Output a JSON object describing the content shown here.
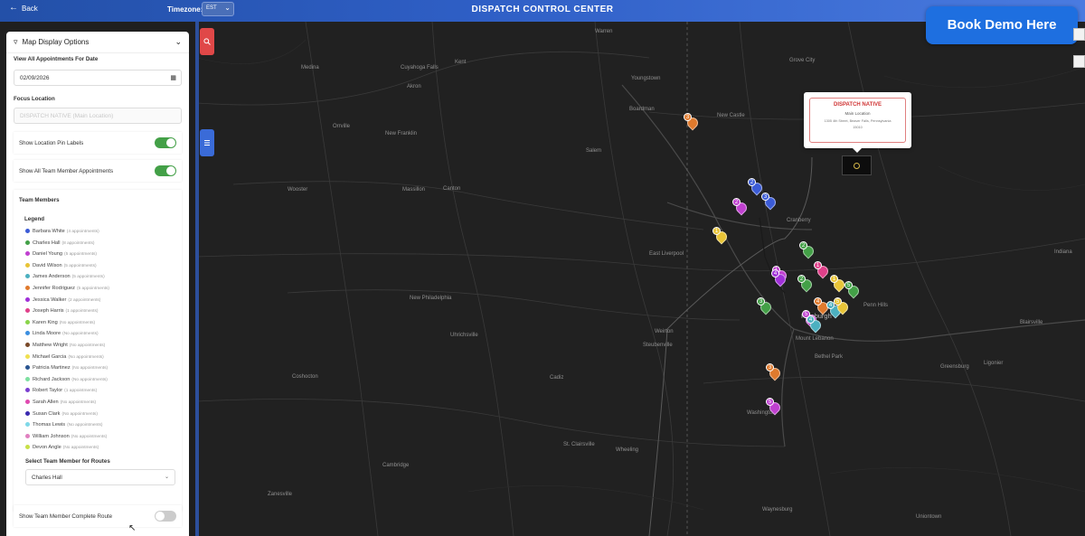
{
  "topbar": {
    "back_label": "Back",
    "timezone_label": "Timezone:",
    "timezone_value": "EST",
    "title": "DISPATCH CONTROL CENTER"
  },
  "demo_button": "Book Demo Here",
  "sidebar": {
    "header": "Map Display Options",
    "date_label": "View All Appointments For Date",
    "date_value": "02/09/2026",
    "focus_label": "Focus Location",
    "focus_value": "DISPATCH NATIVE (Main Location)",
    "show_pin_labels": "Show Location Pin Labels",
    "show_all_appointments": "Show All Team Member Appointments",
    "team_members_title": "Team Members",
    "legend_title": "Legend",
    "legend": [
      {
        "name": "Barbara White",
        "count": "(4 appointments)",
        "color": "#3b5bd6"
      },
      {
        "name": "Charles Hall",
        "count": "(8 appointments)",
        "color": "#43a047"
      },
      {
        "name": "Daniel Young",
        "count": "(5 appointments)",
        "color": "#c040d0"
      },
      {
        "name": "David Wilson",
        "count": "(5 appointments)",
        "color": "#e8c437"
      },
      {
        "name": "James Anderson",
        "count": "(5 appointments)",
        "color": "#4cb0c0"
      },
      {
        "name": "Jennifer Rodriguez",
        "count": "(5 appointments)",
        "color": "#e07a2d"
      },
      {
        "name": "Jessica Walker",
        "count": "(2 appointments)",
        "color": "#a030d8"
      },
      {
        "name": "Joseph Harris",
        "count": "(1 appointments)",
        "color": "#e0408a"
      },
      {
        "name": "Karen King",
        "count": "(No appointments)",
        "color": "#8ad44a"
      },
      {
        "name": "Linda Moore",
        "count": "(No appointments)",
        "color": "#3c8fe0"
      },
      {
        "name": "Matthew Wright",
        "count": "(No appointments)",
        "color": "#7a4a2a"
      },
      {
        "name": "Michael Garcia",
        "count": "(No appointments)",
        "color": "#f0e050"
      },
      {
        "name": "Patricia Martinez",
        "count": "(No appointments)",
        "color": "#2a5590"
      },
      {
        "name": "Richard Jackson",
        "count": "(No appointments)",
        "color": "#7de0a0"
      },
      {
        "name": "Robert Taylor",
        "count": "(1 appointments)",
        "color": "#7a3fd0"
      },
      {
        "name": "Sarah Allen",
        "count": "(No appointments)",
        "color": "#e04ab0"
      },
      {
        "name": "Susan Clark",
        "count": "(No appointments)",
        "color": "#3a2ab0"
      },
      {
        "name": "Thomas Lewis",
        "count": "(No appointments)",
        "color": "#7fd8e8"
      },
      {
        "name": "William Johnson",
        "count": "(No appointments)",
        "color": "#e080c0"
      },
      {
        "name": "Devon Angle",
        "count": "(No appointments)",
        "color": "#c8e048"
      }
    ],
    "routes_label": "Select Team Member for Routes",
    "routes_value": "Charles Hall",
    "complete_route": "Show Team Member Complete Route"
  },
  "popup": {
    "title": "DISPATCH NATIVE",
    "subtitle": "Main Location",
    "address": "1305 4th Street, Beaver Falls, Pennsylvania",
    "zip": "15010"
  },
  "cities": [
    {
      "name": "Warren",
      "big": false
    },
    {
      "name": "Medina",
      "big": false
    },
    {
      "name": "Cuyahoga Falls",
      "big": false
    },
    {
      "name": "Kent",
      "big": false
    },
    {
      "name": "Akron",
      "big": false
    },
    {
      "name": "Youngstown",
      "big": false
    },
    {
      "name": "Grove City",
      "big": false
    },
    {
      "name": "Boardman",
      "big": false
    },
    {
      "name": "New Castle",
      "big": false
    },
    {
      "name": "Orrville",
      "big": false
    },
    {
      "name": "New Franklin",
      "big": false
    },
    {
      "name": "Salem",
      "big": false
    },
    {
      "name": "Wooster",
      "big": false
    },
    {
      "name": "Massillon",
      "big": false
    },
    {
      "name": "Canton",
      "big": false
    },
    {
      "name": "Cranberry",
      "big": false
    },
    {
      "name": "Indiana",
      "big": false
    },
    {
      "name": "East Liverpool",
      "big": false
    },
    {
      "name": "New Philadelphia",
      "big": false
    },
    {
      "name": "Pittsburgh",
      "big": true
    },
    {
      "name": "Penn Hills",
      "big": false
    },
    {
      "name": "Weirton",
      "big": false
    },
    {
      "name": "Steubenville",
      "big": false
    },
    {
      "name": "Mount Lebanon",
      "big": false
    },
    {
      "name": "Blairsville",
      "big": false
    },
    {
      "name": "Uhrichsville",
      "big": false
    },
    {
      "name": "Bethel Park",
      "big": false
    },
    {
      "name": "Greensburg",
      "big": false
    },
    {
      "name": "Coshocton",
      "big": false
    },
    {
      "name": "Cadiz",
      "big": false
    },
    {
      "name": "Ligonier",
      "big": false
    },
    {
      "name": "Washington",
      "big": false
    },
    {
      "name": "St. Clairsville",
      "big": false
    },
    {
      "name": "Wheeling",
      "big": false
    },
    {
      "name": "Cambridge",
      "big": false
    },
    {
      "name": "Zanesville",
      "big": false
    },
    {
      "name": "Uniontown",
      "big": false
    },
    {
      "name": "Waynesburg",
      "big": false
    }
  ],
  "pins": [
    {
      "n": "3",
      "color": "#e07a2d"
    },
    {
      "n": "2",
      "color": "#3b5bd6"
    },
    {
      "n": "3",
      "color": "#3b5bd6"
    },
    {
      "n": "2",
      "color": "#c040d0"
    },
    {
      "n": "1",
      "color": "#e8c437"
    },
    {
      "n": "2",
      "color": "#43a047"
    },
    {
      "n": "1",
      "color": "#c040d0"
    },
    {
      "n": "4",
      "color": "#a030d8"
    },
    {
      "n": "1",
      "color": "#e0408a"
    },
    {
      "n": "2",
      "color": "#43a047"
    },
    {
      "n": "1",
      "color": "#e8c437"
    },
    {
      "n": "5",
      "color": "#43a047"
    },
    {
      "n": "3",
      "color": "#43a047"
    },
    {
      "n": "4",
      "color": "#e07a2d"
    },
    {
      "n": "4",
      "color": "#4cb0c0"
    },
    {
      "n": "5",
      "color": "#c040d0"
    },
    {
      "n": "3",
      "color": "#e07a2d"
    },
    {
      "n": "5",
      "color": "#c040d0"
    },
    {
      "n": "5",
      "color": "#e8c437"
    },
    {
      "n": "4",
      "color": "#4cb0c0"
    }
  ]
}
